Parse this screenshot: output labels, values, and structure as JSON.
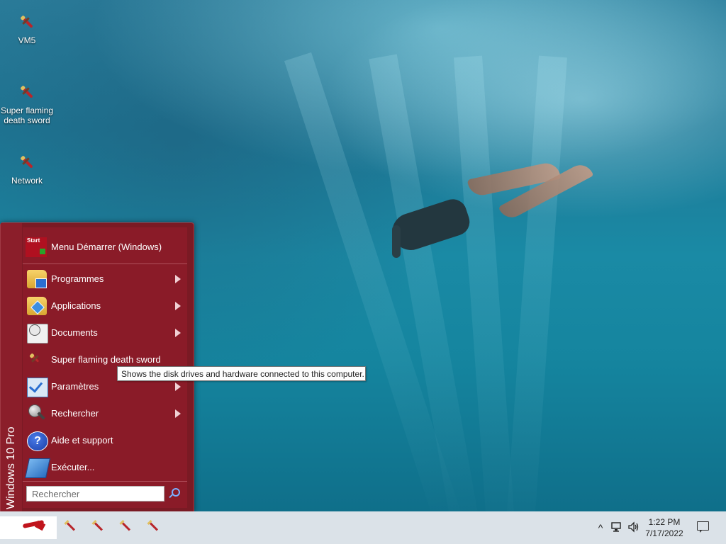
{
  "desktop": {
    "icons": [
      {
        "label": "VM5",
        "icon": "sword-icon"
      },
      {
        "label": "Super flaming death sword",
        "icon": "sword-icon"
      },
      {
        "label": "Network",
        "icon": "sword-icon"
      }
    ]
  },
  "start_menu": {
    "side_label": "Windows 10 Pro",
    "header": {
      "icon_text": "Start",
      "label": "Menu Démarrer (Windows)"
    },
    "items": [
      {
        "label": "Programmes",
        "icon": "programs-folder-icon",
        "has_submenu": true
      },
      {
        "label": "Applications",
        "icon": "applications-folder-icon",
        "has_submenu": true
      },
      {
        "label": "Documents",
        "icon": "documents-icon",
        "has_submenu": true
      },
      {
        "label": "Super flaming death sword",
        "icon": "sword-icon",
        "has_submenu": false
      },
      {
        "label": "Paramètres",
        "icon": "settings-icon",
        "has_submenu": true
      },
      {
        "label": "Rechercher",
        "icon": "search-magnifier-icon",
        "has_submenu": true
      },
      {
        "label": "Aide et support",
        "icon": "help-icon",
        "has_submenu": false
      },
      {
        "label": "Exécuter...",
        "icon": "run-icon",
        "has_submenu": false
      }
    ],
    "search": {
      "placeholder": "Rechercher"
    }
  },
  "tooltip": {
    "text": "Shows the disk drives and hardware connected to this computer."
  },
  "taskbar": {
    "pinned": [
      "sword-icon",
      "sword-icon",
      "sword-icon",
      "sword-icon"
    ],
    "tray": {
      "chevron": "^",
      "time": "1:22 PM",
      "date": "7/17/2022"
    }
  },
  "colors": {
    "menu_bg": "#8a1b28",
    "taskbar_bg": "#dbe2e8"
  }
}
